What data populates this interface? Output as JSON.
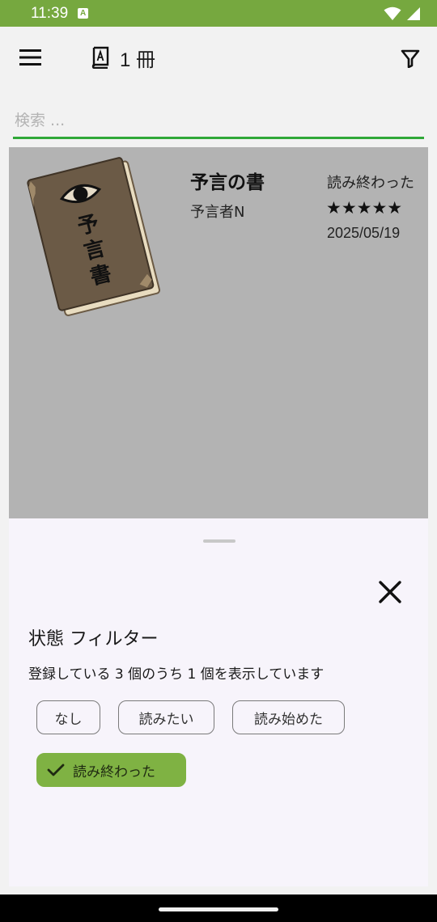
{
  "status_bar": {
    "time": "11:39",
    "badge": "A",
    "icons": [
      "wifi-icon",
      "signal-icon"
    ],
    "color": "#76a83f"
  },
  "app_bar": {
    "menu_icon": "hamburger-menu-icon",
    "book_icon": "book-icon",
    "count_label": "1 冊",
    "filter_icon": "filter-icon"
  },
  "search": {
    "placeholder": "検索 ...",
    "value": "",
    "accent": "#2fa838"
  },
  "books": [
    {
      "title": "予言の書",
      "author": "予言者N",
      "status": "読み終わった",
      "rating": "★★★★★",
      "date": "2025/05/19",
      "cover_text": "予言書"
    }
  ],
  "filter_sheet": {
    "title": "状態 フィルター",
    "subtitle": "登録している 3 個のうち 1 個を表示しています",
    "close_icon": "close-icon",
    "chips": {
      "none": "なし",
      "want": "読みたい",
      "started": "読み始めた",
      "done": "読み終わった"
    },
    "selected_chip": "done",
    "selected_color": "#7fb243"
  }
}
